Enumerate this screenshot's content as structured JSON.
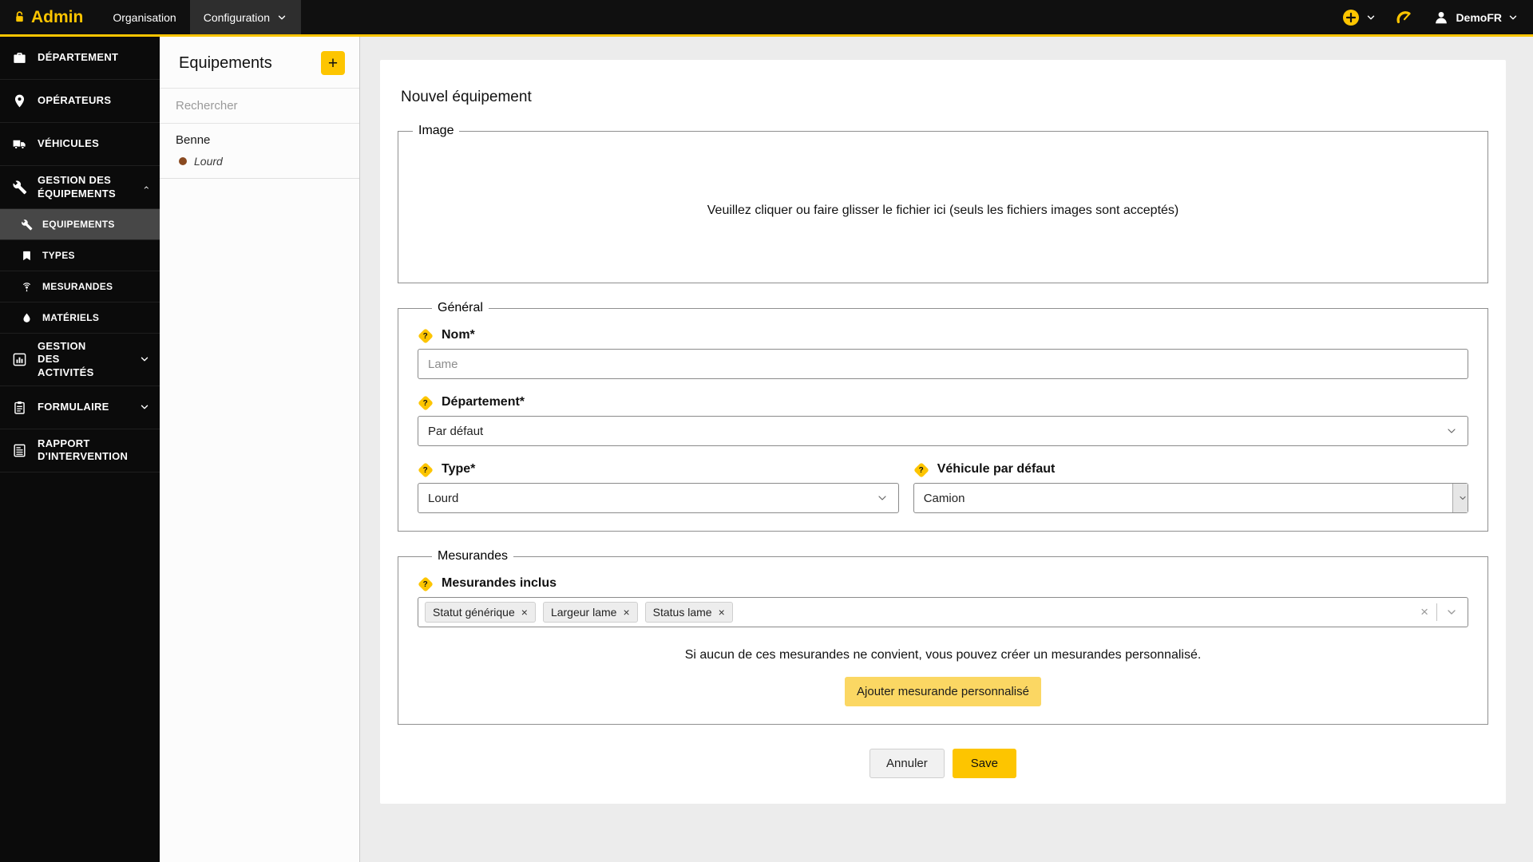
{
  "colors": {
    "accent": "#fdc500",
    "accent_soft": "#fbd763",
    "benne_dot": "#8a4a21"
  },
  "glyphs": {
    "question": "?",
    "remove": "×",
    "clear": "×",
    "add": "+"
  },
  "topbar": {
    "brand": "Admin",
    "nav": [
      {
        "label": "Organisation"
      },
      {
        "label": "Configuration"
      }
    ],
    "user": {
      "name": "DemoFR"
    }
  },
  "sidebar": {
    "items": [
      {
        "label": "DÉPARTEMENT"
      },
      {
        "label": "OPÉRATEURS"
      },
      {
        "label": "VÉHICULES"
      },
      {
        "label": "GESTION DES ÉQUIPEMENTS"
      },
      {
        "label": "GESTION DES ACTIVITÉS"
      },
      {
        "label": "FORMULAIRE"
      },
      {
        "label": "RAPPORT D'INTERVENTION"
      }
    ],
    "equipment_submenu": [
      {
        "label": "EQUIPEMENTS"
      },
      {
        "label": "TYPES"
      },
      {
        "label": "MESURANDES"
      },
      {
        "label": "MATÉRIELS"
      }
    ]
  },
  "panel": {
    "title": "Equipements",
    "search_placeholder": "Rechercher",
    "groups": [
      {
        "name": "Benne",
        "items": [
          {
            "label": "Lourd"
          }
        ]
      }
    ]
  },
  "form": {
    "title": "Nouvel équipement",
    "image": {
      "legend": "Image",
      "dropzone": "Veuillez cliquer ou faire glisser le fichier ici (seuls les fichiers images sont acceptés)"
    },
    "general": {
      "legend": "Général",
      "nom": {
        "label": "Nom*",
        "placeholder": "Lame"
      },
      "departement": {
        "label": "Département*",
        "value": "Par défaut"
      },
      "type": {
        "label": "Type*",
        "value": "Lourd"
      },
      "vehicule": {
        "label": "Véhicule par défaut",
        "value": "Camion"
      }
    },
    "mesurandes": {
      "legend": "Mesurandes",
      "label": "Mesurandes inclus",
      "tags": [
        {
          "label": "Statut générique"
        },
        {
          "label": "Largeur lame"
        },
        {
          "label": "Status lame"
        }
      ],
      "hint": "Si aucun de ces mesurandes ne convient, vous pouvez créer un mesurandes personnalisé.",
      "add_button": "Ajouter mesurande personnalisé"
    },
    "actions": {
      "cancel": "Annuler",
      "save": "Save"
    }
  }
}
